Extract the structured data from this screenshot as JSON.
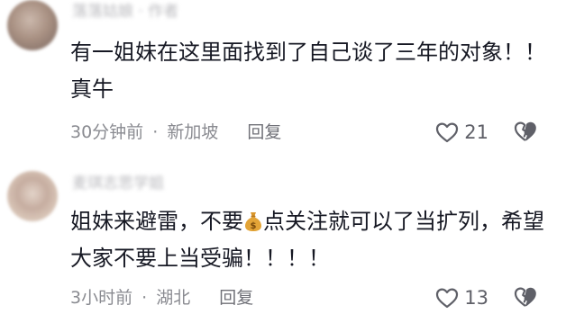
{
  "comments": [
    {
      "username": "落落姑娘 · 作者",
      "text_before": "有一姐妹在这里面找到了自己谈了三年的对象！！真牛",
      "text_after": "",
      "time": "30分钟前",
      "separator": "·",
      "location": "新加坡",
      "reply_label": "回复",
      "likes": "21",
      "icons": {
        "like": "heart-outline-icon",
        "dislike": "broken-heart-icon"
      }
    },
    {
      "username": "麦琪志思学姐",
      "text_before": "姐妹来避雷，不要",
      "text_after": "点关注就可以了当扩列，希望大家不要上当受骗！！！！",
      "time": "3小时前",
      "separator": "·",
      "location": "湖北",
      "reply_label": "回复",
      "likes": "13",
      "icons": {
        "emoji": "money-bag-emoji",
        "like": "heart-outline-icon",
        "dislike": "broken-heart-icon"
      }
    }
  ],
  "colors": {
    "text_primary": "#161823",
    "text_secondary": "#8a8b91",
    "icon_gray": "#5f6068",
    "money_bag": "#e3a437"
  }
}
